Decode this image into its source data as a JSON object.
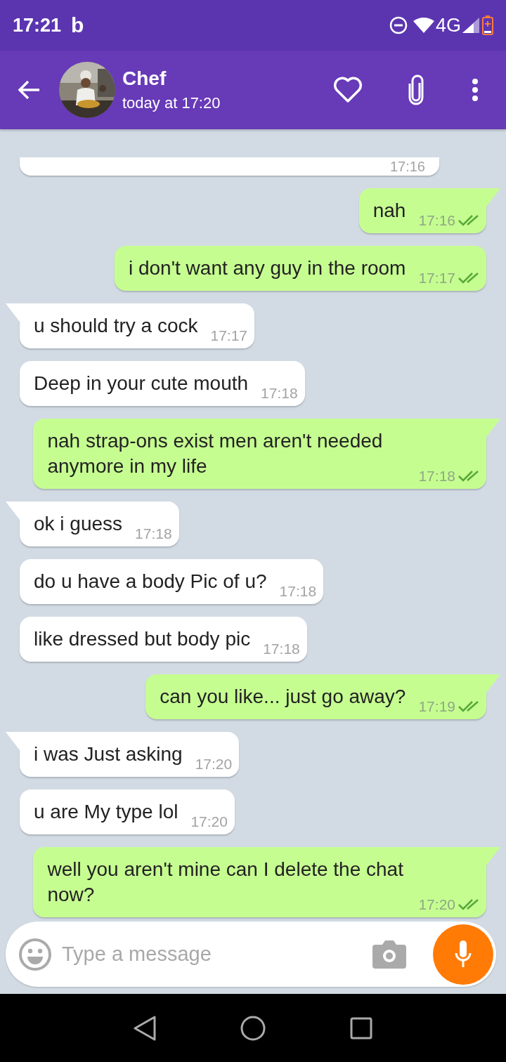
{
  "status_bar": {
    "time": "17:21",
    "notification_icon": "b",
    "network": "4G"
  },
  "header": {
    "name": "Chef",
    "last_seen": "today at 17:20"
  },
  "cut_message": {
    "kind": "in",
    "time": "17:16"
  },
  "messages": [
    {
      "kind": "out",
      "text": "nah",
      "time": "17:16",
      "read": true,
      "tail": true
    },
    {
      "kind": "out",
      "text": "i don't want any guy in the room",
      "time": "17:17",
      "read": true,
      "tail": false
    },
    {
      "kind": "in",
      "text": "u should try a cock",
      "time": "17:17",
      "tail": true
    },
    {
      "kind": "in",
      "text": "Deep in your cute mouth",
      "time": "17:18",
      "tail": false
    },
    {
      "kind": "out",
      "text": "nah strap-ons exist men aren't needed anymore in my life",
      "time": "17:18",
      "read": true,
      "tail": true
    },
    {
      "kind": "in",
      "text": "ok i guess",
      "time": "17:18",
      "tail": true
    },
    {
      "kind": "in",
      "text": "do u have a body Pic of u?",
      "time": "17:18",
      "tail": false
    },
    {
      "kind": "in",
      "text": "like dressed but body pic",
      "time": "17:18",
      "tail": false
    },
    {
      "kind": "out",
      "text": "can you like... just go away?",
      "time": "17:19",
      "read": true,
      "tail": true
    },
    {
      "kind": "in",
      "text": "i was Just asking",
      "time": "17:20",
      "tail": true
    },
    {
      "kind": "in",
      "text": "u are My type lol",
      "time": "17:20",
      "tail": false
    },
    {
      "kind": "out",
      "text": "well you aren't mine can I delete the chat now?",
      "time": "17:20",
      "read": true,
      "tail": true
    }
  ],
  "composer": {
    "placeholder": "Type a message"
  }
}
